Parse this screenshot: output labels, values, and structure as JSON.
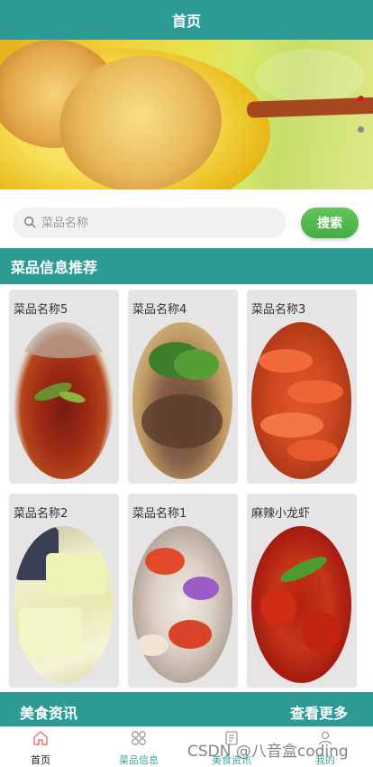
{
  "header": {
    "title": "首页"
  },
  "banner": {
    "indicator_count": 2,
    "active_index": 1
  },
  "search": {
    "placeholder": "菜品名称",
    "button_label": "搜索"
  },
  "recommend": {
    "title": "菜品信息推荐",
    "items": [
      {
        "name": "菜品名称5"
      },
      {
        "name": "菜品名称4"
      },
      {
        "name": "菜品名称3"
      },
      {
        "name": "菜品名称2"
      },
      {
        "name": "菜品名称1"
      },
      {
        "name": "麻辣小龙虾"
      }
    ]
  },
  "news": {
    "title": "美食资讯",
    "more_label": "查看更多"
  },
  "tabbar": {
    "items": [
      {
        "label": "首页",
        "icon": "home-icon",
        "active": true
      },
      {
        "label": "菜品信息",
        "icon": "grid-icon",
        "active": false
      },
      {
        "label": "美食资讯",
        "icon": "news-icon",
        "active": false
      },
      {
        "label": "我的",
        "icon": "user-icon",
        "active": false
      }
    ]
  },
  "watermark": {
    "text": "CSDN @八音盒coding"
  },
  "colors": {
    "primary": "#2e9a94",
    "button": "#4fb74b",
    "indicator_active": "#e01515"
  }
}
